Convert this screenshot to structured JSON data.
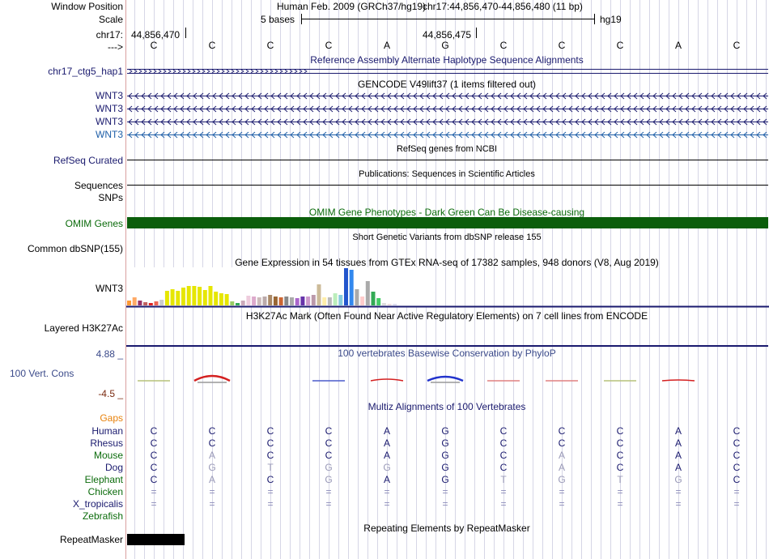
{
  "labels": {
    "window_position": "Window Position",
    "scale": "Scale",
    "chr": "chr17:",
    "arrow": "--->",
    "alt_haplotype": "chr17_ctg5_hap1",
    "wnt3_1": "WNT3",
    "wnt3_2": "WNT3",
    "wnt3_3": "WNT3",
    "wnt3_4": "WNT3",
    "refseq": "RefSeq Curated",
    "sequences": "Sequences",
    "snps": "SNPs",
    "omim": "OMIM Genes",
    "dbsnp": "Common dbSNP(155)",
    "gtex": "WNT3",
    "h3k27ac": "Layered H3K27Ac",
    "cons_max": "4.88 _",
    "cons": "100 Vert. Cons",
    "cons_min": "-4.5 _",
    "gaps": "Gaps",
    "repeatmasker": "RepeatMasker"
  },
  "header": {
    "assembly": "Human Feb. 2009 (GRCh37/hg19)",
    "position": "chr17:44,856,470-44,856,480 (11 bp)",
    "scale_text": "5 bases",
    "scale_db": "hg19",
    "coord1": "44,856,470",
    "coord2": "44,856,475"
  },
  "reference_bases": [
    "C",
    "C",
    "C",
    "C",
    "A",
    "G",
    "C",
    "C",
    "C",
    "A",
    "C"
  ],
  "tracks": {
    "alt_haplotype_title": "Reference Assembly Alternate Haplotype Sequence Alignments",
    "gencode_title": "GENCODE V49lift37 (1 items filtered out)",
    "refseq_title": "RefSeq genes from NCBI",
    "publications_title": "Publications: Sequences in Scientific Articles",
    "omim_title": "OMIM Gene Phenotypes - Dark Green Can Be Disease-causing",
    "dbsnp_title": "Short Genetic Variants from dbSNP release 155",
    "gtex_title": "Gene Expression in 54 tissues from GTEx RNA-seq of 17382 samples, 948 donors (V8, Aug 2019)",
    "h3k27ac_title": "H3K27Ac Mark (Often Found Near Active Regulatory Elements) on 7 cell lines from ENCODE",
    "cons_title": "100 vertebrates Basewise Conservation by PhyloP",
    "multiz_title": "Multiz Alignments of 100 Vertebrates",
    "repeatmasker_title": "Repeating Elements by RepeatMasker"
  },
  "multiz": [
    {
      "species": "Human",
      "bases": [
        "C",
        "C",
        "C",
        "C",
        "A",
        "G",
        "C",
        "C",
        "C",
        "A",
        "C"
      ]
    },
    {
      "species": "Rhesus",
      "bases": [
        "C",
        "C",
        "C",
        "C",
        "A",
        "G",
        "C",
        "C",
        "C",
        "A",
        "C"
      ]
    },
    {
      "species": "Mouse",
      "bases": [
        "C",
        "A",
        "C",
        "C",
        "A",
        "G",
        "C",
        "A",
        "C",
        "A",
        "C"
      ]
    },
    {
      "species": "Dog",
      "bases": [
        "C",
        "G",
        "T",
        "G",
        "G",
        "G",
        "C",
        "A",
        "C",
        "A",
        "C"
      ]
    },
    {
      "species": "Elephant",
      "bases": [
        "C",
        "A",
        "C",
        "G",
        "A",
        "G",
        "T",
        "G",
        "T",
        "G",
        "C"
      ]
    },
    {
      "species": "Chicken",
      "bases": [
        "=",
        "=",
        "=",
        "=",
        "=",
        "=",
        "=",
        "=",
        "=",
        "=",
        "="
      ]
    },
    {
      "species": "X_tropicalis",
      "bases": [
        "=",
        "=",
        "=",
        "=",
        "=",
        "=",
        "=",
        "=",
        "=",
        "=",
        "="
      ]
    },
    {
      "species": "Zebrafish",
      "bases": [
        "",
        "",
        "",
        "",
        "",
        "",
        "",
        "",
        "",
        "",
        ""
      ]
    }
  ],
  "gtex_bars": [
    {
      "value": 6,
      "color": "#ff9933"
    },
    {
      "value": 10,
      "color": "#ffaa66"
    },
    {
      "value": 6,
      "color": "#993366"
    },
    {
      "value": 4,
      "color": "#c06060"
    },
    {
      "value": 3,
      "color": "#dd2222"
    },
    {
      "value": 5,
      "color": "#ee6655"
    },
    {
      "value": 7,
      "color": "#cccccc"
    },
    {
      "value": 18,
      "color": "#e6e600"
    },
    {
      "value": 20,
      "color": "#e6e600"
    },
    {
      "value": 18,
      "color": "#e6e600"
    },
    {
      "value": 22,
      "color": "#e6e600"
    },
    {
      "value": 24,
      "color": "#e6e600"
    },
    {
      "value": 24,
      "color": "#e6e600"
    },
    {
      "value": 23,
      "color": "#e6e600"
    },
    {
      "value": 19,
      "color": "#e6e600"
    },
    {
      "value": 24,
      "color": "#e6e600"
    },
    {
      "value": 17,
      "color": "#e6e600"
    },
    {
      "value": 15,
      "color": "#e6e600"
    },
    {
      "value": 14,
      "color": "#e6e600"
    },
    {
      "value": 5,
      "color": "#99cc66"
    },
    {
      "value": 3,
      "color": "#33aa55"
    },
    {
      "value": 6,
      "color": "#ccaabb"
    },
    {
      "value": 12,
      "color": "#eeccdd"
    },
    {
      "value": 11,
      "color": "#ddaacc"
    },
    {
      "value": 10,
      "color": "#ccbbbb"
    },
    {
      "value": 11,
      "color": "#bbaaaa"
    },
    {
      "value": 13,
      "color": "#aa8866"
    },
    {
      "value": 11,
      "color": "#996633"
    },
    {
      "value": 10,
      "color": "#cc6633"
    },
    {
      "value": 11,
      "color": "#888888"
    },
    {
      "value": 10,
      "color": "#aaaaaa"
    },
    {
      "value": 9,
      "color": "#aa66cc"
    },
    {
      "value": 11,
      "color": "#6633aa"
    },
    {
      "value": 11,
      "color": "#cc99cc"
    },
    {
      "value": 13,
      "color": "#bb99aa"
    },
    {
      "value": 26,
      "color": "#ccbb99"
    },
    {
      "value": 10,
      "color": "#ffeeaa"
    },
    {
      "value": 10,
      "color": "#bbbbbb"
    },
    {
      "value": 15,
      "color": "#bbeebb"
    },
    {
      "value": 13,
      "color": "#88ccdd"
    },
    {
      "value": 46,
      "color": "#2255cc"
    },
    {
      "value": 44,
      "color": "#3388ee"
    },
    {
      "value": 20,
      "color": "#aaaaaa"
    },
    {
      "value": 11,
      "color": "#ffcccc"
    },
    {
      "value": 30,
      "color": "#aaaaaa"
    },
    {
      "value": 17,
      "color": "#33aa55"
    },
    {
      "value": 9,
      "color": "#44cc66"
    },
    {
      "value": 3,
      "color": "#dddddd"
    },
    {
      "value": 2,
      "color": "#eedddd"
    },
    {
      "value": 2,
      "color": "#ddddee"
    }
  ],
  "colors": {
    "navy": "#1a1a6e",
    "omim_green": "#0b5e0b",
    "repeat_black": "#000000",
    "left_rule": "#d9a0a0",
    "grid": "#d6d6e6"
  }
}
